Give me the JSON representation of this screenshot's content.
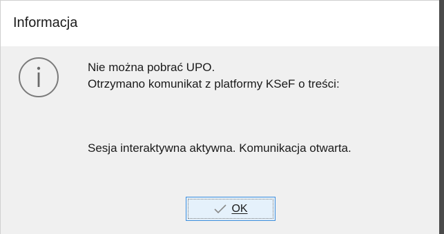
{
  "dialog": {
    "title": "Informacja",
    "icon": "info-icon",
    "message": {
      "line1": "Nie można pobrać UPO.",
      "line2": "Otrzymano komunikat z platformy KSeF o treści:",
      "line3": "Sesja interaktywna aktywna. Komunikacja otwarta."
    },
    "ok_button": {
      "icon": "check-icon",
      "label": "OK"
    }
  },
  "colors": {
    "body_bg": "#f0f0f0",
    "button_bg": "#e5f1fb",
    "button_border": "#3c8ddc"
  }
}
